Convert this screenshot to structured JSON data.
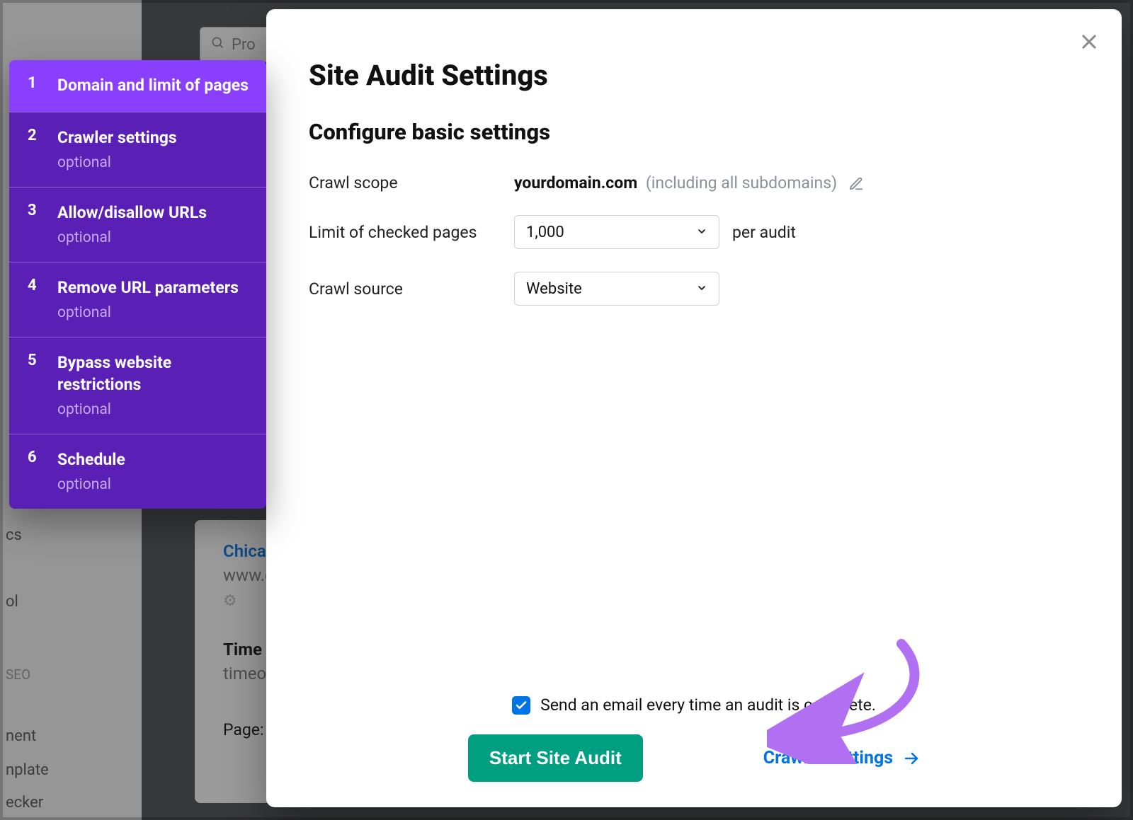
{
  "background": {
    "search_placeholder": "Pro",
    "card_link": "Chicago",
    "card_url": "www.ch",
    "card_time": "Time O",
    "card_time_sub": "timeout",
    "card_page": "Page:",
    "nav_fragments": [
      "cs",
      "ol",
      "SEO",
      "nent",
      "nplate",
      "ecker"
    ]
  },
  "stepper": {
    "items": [
      {
        "num": "1",
        "title": "Domain and limit of pages",
        "tag": "",
        "active": true
      },
      {
        "num": "2",
        "title": "Crawler settings",
        "tag": "optional",
        "active": false
      },
      {
        "num": "3",
        "title": "Allow/disallow URLs",
        "tag": "optional",
        "active": false
      },
      {
        "num": "4",
        "title": "Remove URL parameters",
        "tag": "optional",
        "active": false
      },
      {
        "num": "5",
        "title": "Bypass website restrictions",
        "tag": "optional",
        "active": false
      },
      {
        "num": "6",
        "title": "Schedule",
        "tag": "optional",
        "active": false
      }
    ]
  },
  "modal": {
    "title": "Site Audit Settings",
    "subtitle": "Configure basic settings",
    "scope_label": "Crawl scope",
    "scope_domain": "yourdomain.com",
    "scope_note": "(including all subdomains)",
    "limit_label": "Limit of checked pages",
    "limit_value": "1,000",
    "per_audit": "per audit",
    "source_label": "Crawl source",
    "source_value": "Website",
    "email_text": "Send an email every time an audit is complete.",
    "email_checked": true,
    "start_button": "Start Site Audit",
    "crawler_link": "Crawler settings"
  }
}
